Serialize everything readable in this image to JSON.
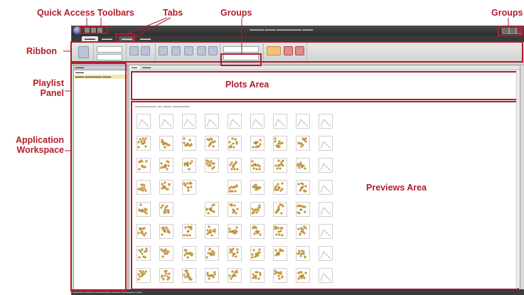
{
  "callouts": {
    "quick_access_toolbars": "Quick Access Toolbars",
    "tabs": "Tabs",
    "groups_top": "Groups",
    "groups_right": "Groups",
    "ribbon": "Ribbon",
    "playlist_panel_line1": "Playlist",
    "playlist_panel_line2": "Panel",
    "application_workspace_line1": "Application",
    "application_workspace_line2": "Workspace",
    "plots_area": "Plots Area",
    "previews_area": "Previews Area"
  },
  "colors": {
    "annotation": "#b01e2a",
    "titlebar": "#2e2e2e",
    "ribbon": "#dcdcdc",
    "playlist_selection": "#f1e6b3",
    "thumbnail_plot": "#c9963e"
  },
  "icons": {
    "app_logo": "app-logo-icon",
    "ribbon_buttons": "ribbon-tool-icon",
    "thumbnail": "scatter-plot-thumbnail-icon"
  },
  "preview_grid": {
    "rows": 8,
    "columns": 9
  }
}
